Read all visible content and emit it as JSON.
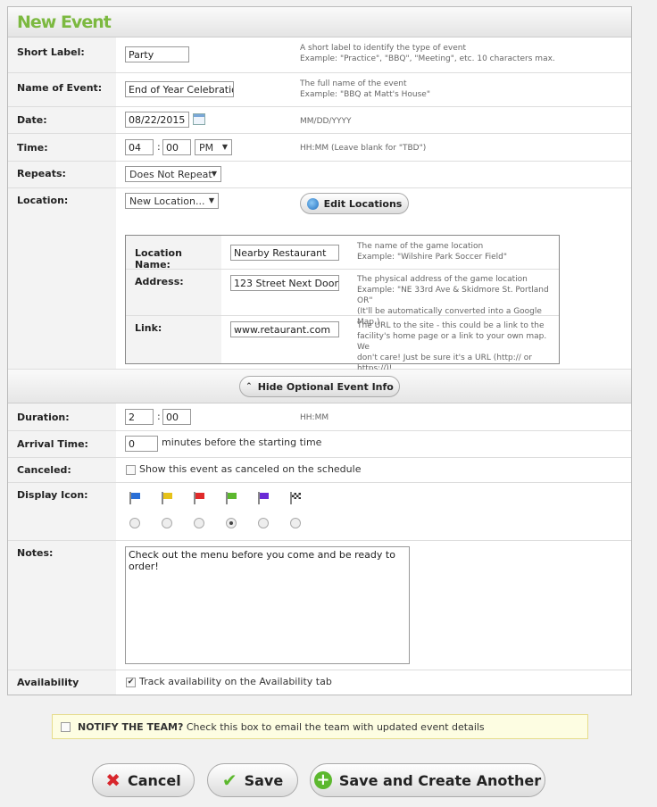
{
  "title": "New Event",
  "fields": {
    "short_label": {
      "label": "Short Label:",
      "value": "Party",
      "help1": "A short label to identify the type of event",
      "help2": "Example: \"Practice\", \"BBQ\", \"Meeting\", etc. 10 characters max."
    },
    "name": {
      "label": "Name of Event:",
      "value": "End of Year Celebration",
      "help1": "The full name of the event",
      "help2": "Example: \"BBQ at Matt's House\""
    },
    "date": {
      "label": "Date:",
      "value": "08/22/2015",
      "help": "MM/DD/YYYY"
    },
    "time": {
      "label": "Time:",
      "hour": "04",
      "minute": "00",
      "ampm": "PM",
      "help": "HH:MM (Leave blank for \"TBD\")"
    },
    "repeats": {
      "label": "Repeats:",
      "value": "Does Not Repeat"
    },
    "location": {
      "label": "Location:",
      "value": "New Location...",
      "edit_label": "Edit Locations",
      "name": {
        "label": "Location Name:",
        "value": "Nearby Restaurant",
        "help1": "The name of the game location",
        "help2": "Example: \"Wilshire Park Soccer Field\""
      },
      "address": {
        "label": "Address:",
        "value": "123 Street Next Door",
        "help1": "The physical address of the game location",
        "help2": "Example: \"NE 33rd Ave & Skidmore St. Portland OR\"",
        "help3": "(It'll be automatically converted into a Google Map.)"
      },
      "link": {
        "label": "Link:",
        "value": "www.retaurant.com",
        "help1": "The URL to the site - this could be a link to the",
        "help2": "facility's home page or a link to your own map. We",
        "help3": "don't care! Just be sure it's a URL (http:// or https://)!"
      }
    },
    "toggle_optional": "Hide Optional Event Info",
    "duration": {
      "label": "Duration:",
      "hours": "2",
      "minutes": "00",
      "help": "HH:MM"
    },
    "arrival": {
      "label": "Arrival Time:",
      "value": "0",
      "suffix": "minutes before the starting time"
    },
    "canceled": {
      "label": "Canceled:",
      "text": "Show this event as canceled on the schedule",
      "checked": false
    },
    "display_icon": {
      "label": "Display Icon:",
      "icons": [
        {
          "name": "blue-flag",
          "color": "#2a6fd6"
        },
        {
          "name": "yellow-flag",
          "color": "#e6c21a"
        },
        {
          "name": "red-flag",
          "color": "#e02a2a"
        },
        {
          "name": "green-flag",
          "color": "#5cb82e"
        },
        {
          "name": "purple-flag",
          "color": "#6a2ad6"
        },
        {
          "name": "checkered-flag",
          "color": "#555555"
        }
      ],
      "selected": 3
    },
    "notes": {
      "label": "Notes:",
      "value": "Check out the menu before you come and be ready to order!"
    },
    "availability": {
      "label": "Availability",
      "text": "Track availability on the Availability tab",
      "checked": true
    }
  },
  "notify": {
    "bold": "NOTIFY THE TEAM?",
    "text": "Check this box to email the team with updated event details",
    "checked": false
  },
  "buttons": {
    "cancel": "Cancel",
    "save": "Save",
    "save_another": "Save and Create Another"
  }
}
